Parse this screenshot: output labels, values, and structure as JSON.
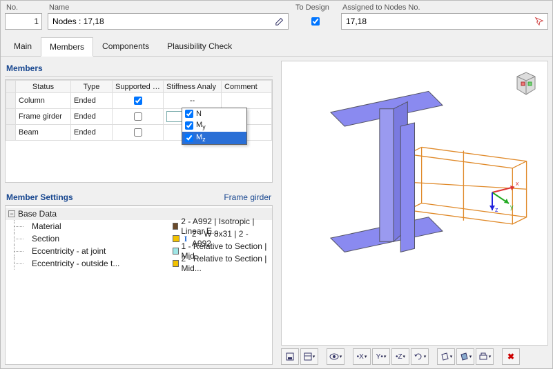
{
  "header": {
    "no_label": "No.",
    "no_value": "1",
    "name_label": "Name",
    "name_value": "Nodes : 17,18",
    "to_design_label": "To Design",
    "to_design_checked": true,
    "assigned_label": "Assigned to Nodes No.",
    "assigned_value": "17,18"
  },
  "tabs": [
    "Main",
    "Members",
    "Components",
    "Plausibility Check"
  ],
  "active_tab": "Members",
  "members_section_title": "Members",
  "members_table": {
    "columns": [
      "",
      "Status",
      "Type",
      "Supported En",
      "Stiffness Analy",
      "Comment"
    ],
    "rows": [
      {
        "status": "Column",
        "type": "Ended",
        "supported": true,
        "stiffness": "--",
        "comment": ""
      },
      {
        "status": "Frame girder",
        "type": "Ended",
        "supported": false,
        "stiffness": "",
        "comment": "",
        "selected": true,
        "combo_open": true
      },
      {
        "status": "Beam",
        "type": "Ended",
        "supported": false,
        "stiffness": "",
        "comment": ""
      }
    ],
    "dropdown_options": [
      {
        "label": "N",
        "checked": true,
        "hl": false
      },
      {
        "label": "My",
        "checked": true,
        "hl": false
      },
      {
        "label": "Mz",
        "checked": true,
        "hl": true
      }
    ]
  },
  "member_settings": {
    "title": "Member Settings",
    "subject": "Frame girder",
    "group": "Base Data",
    "rows": [
      {
        "key": "Material",
        "swatch": "#6b4b2a",
        "icon": "",
        "value": "2 - A992 | Isotropic | Linear E..."
      },
      {
        "key": "Section",
        "swatch": "#f2c200",
        "icon": "I",
        "value": "2 - W 8x31 | 2 - A992"
      },
      {
        "key": "Eccentricity - at joint",
        "swatch": "#9fe6e6",
        "icon": "",
        "value": "1 - Relative to Section | Mid..."
      },
      {
        "key": "Eccentricity - outside t...",
        "swatch": "#f2c200",
        "icon": "",
        "value": "2 - Relative to Section | Mid..."
      }
    ]
  },
  "toolbar_icons": [
    {
      "name": "view-save-icon"
    },
    {
      "name": "view-list-icon",
      "drop": true
    },
    {
      "name": "eye-icon",
      "drop": true
    },
    {
      "name": "axis-x-icon",
      "drop": true
    },
    {
      "name": "axis-y-icon",
      "drop": true
    },
    {
      "name": "axis-z-icon",
      "drop": true
    },
    {
      "name": "rotate-icon",
      "drop": true
    },
    {
      "name": "wireframe-icon",
      "drop": true
    },
    {
      "name": "shaded-icon",
      "drop": true
    },
    {
      "name": "print-icon",
      "drop": true
    },
    {
      "name": "reset-icon",
      "red": true
    }
  ]
}
